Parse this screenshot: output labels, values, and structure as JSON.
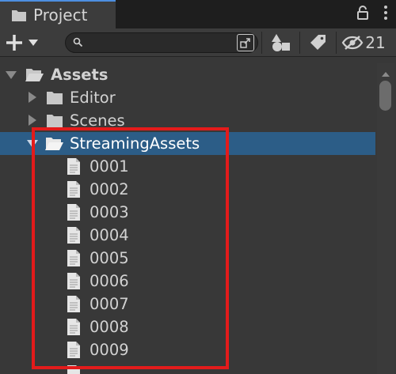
{
  "window": {
    "tab_title": "Project",
    "tab_icon": "folder-icon",
    "lock_icon": "lock-icon",
    "menu_icon": "kebab-menu-icon"
  },
  "toolbar": {
    "create_icon": "plus-icon",
    "search": {
      "value": "",
      "placeholder": "",
      "icon": "search-icon",
      "trailing_icon": "search-by-type-icon"
    },
    "filter_type_icon": "shapes-icon",
    "filter_label_icon": "tag-icon",
    "hidden_packages_icon": "eye-slash-icon",
    "hidden_packages_count": "21"
  },
  "tree": {
    "root": {
      "label": "Assets",
      "expanded": true
    },
    "folders": [
      {
        "label": "Editor",
        "expanded": false
      },
      {
        "label": "Scenes",
        "expanded": false
      },
      {
        "label": "StreamingAssets",
        "expanded": true,
        "selected": true
      }
    ],
    "files": [
      "0001",
      "0002",
      "0003",
      "0004",
      "0005",
      "0006",
      "0007",
      "0008",
      "0009"
    ]
  },
  "colors": {
    "background": "#383838",
    "toolbar": "#3c3c3c",
    "selection": "#2c5d87",
    "annotation": "#e31b1b",
    "tab_accent": "#4d8fe0"
  }
}
